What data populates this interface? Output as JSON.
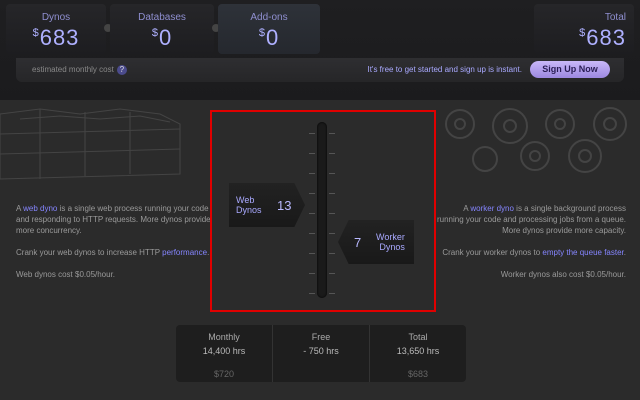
{
  "header": {
    "dynos": {
      "label": "Dynos",
      "currency": "$",
      "value": "683"
    },
    "databases": {
      "label": "Databases",
      "currency": "$",
      "value": "0"
    },
    "addons": {
      "label": "Add-ons",
      "currency": "$",
      "value": "0"
    },
    "total": {
      "label": "Total",
      "currency": "$",
      "value": "683"
    }
  },
  "info_bar": {
    "estimated_label": "estimated monthly cost",
    "help_icon": "?",
    "free_text": "It's free to get started and sign up is instant.",
    "signup_label": "Sign Up Now"
  },
  "left_desc": {
    "p1_pre": "A ",
    "p1_link": "web dyno",
    "p1_post": " is a single web process running your code and responding to HTTP requests. More dynos provide more concurrency.",
    "p2_pre": "Crank your web dynos to increase HTTP ",
    "p2_link": "performance",
    "p2_post": ".",
    "p3": "Web dynos cost $0.05/hour."
  },
  "right_desc": {
    "p1_pre": "A ",
    "p1_link": "worker dyno",
    "p1_post": " is a single background process running your code and processing jobs from a queue. More dynos provide more capacity.",
    "p2_pre": "Crank your worker dynos to ",
    "p2_link": "empty the queue faster",
    "p2_post": ".",
    "p3": "Worker dynos also cost $0.05/hour."
  },
  "slider": {
    "web": {
      "label_line1": "Web",
      "label_line2": "Dynos",
      "value": "13"
    },
    "worker": {
      "label_line1": "Worker",
      "label_line2": "Dynos",
      "value": "7"
    }
  },
  "summary": {
    "monthly": {
      "label": "Monthly",
      "hours": "14,400 hrs",
      "cost": "$720"
    },
    "free": {
      "label": "Free",
      "hours": "- 750 hrs",
      "cost": ""
    },
    "total": {
      "label": "Total",
      "hours": "13,650 hrs",
      "cost": "$683"
    }
  },
  "colors": {
    "accent": "#aeb0ff",
    "link": "#8585ff",
    "signup": "#b8a6f0",
    "highlight_frame": "#e00000"
  }
}
